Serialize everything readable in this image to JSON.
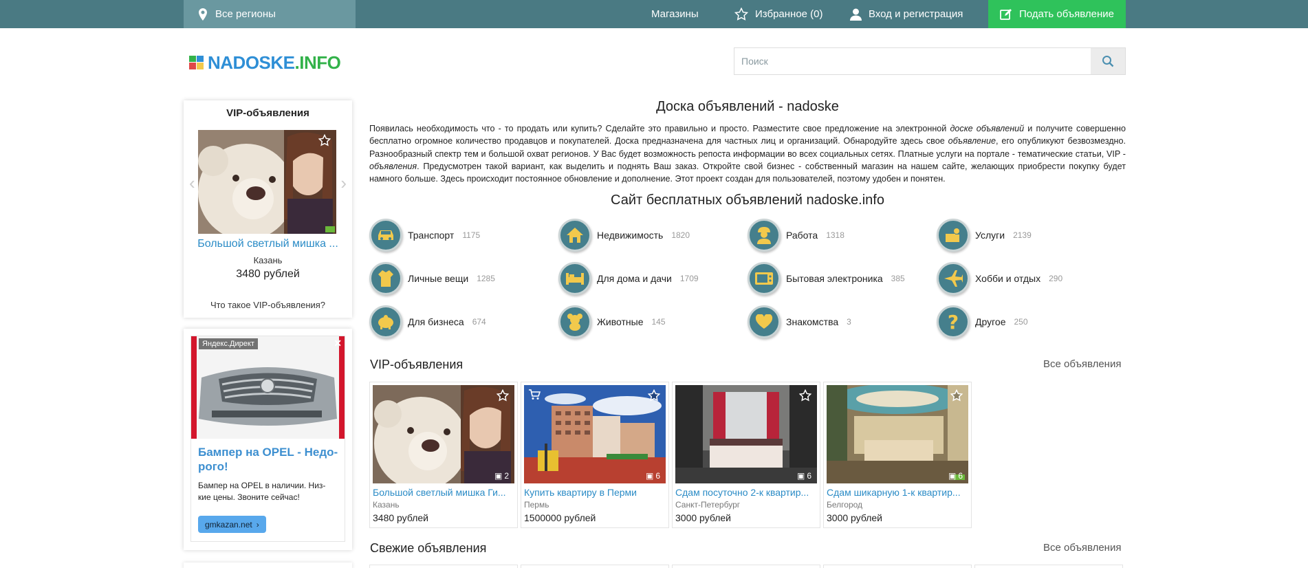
{
  "topbar": {
    "region": "Все регионы",
    "shops": "Магазины",
    "favorites": "Избранное (0)",
    "login": "Вход и регистрация",
    "post": "Подать объявление"
  },
  "header": {
    "logo_a": "NADOSKE",
    "logo_b": ".INFO",
    "search_placeholder": "Поиск"
  },
  "vip_box": {
    "title": "VIP-объявления",
    "item_title": "Большой светлый мишка ...",
    "item_city": "Казань",
    "item_price": "3480 рублей",
    "what_is": "Что такое VIP-объявления?"
  },
  "ad": {
    "label": "Яндекс.Директ",
    "title": "Бампер на OPEL - Недо-рого!",
    "text": "Бампер на OPEL в наличии. Низ-кие цены. Звоните сейчас!",
    "button": "gmkazan.net"
  },
  "main": {
    "h1": "Доска объявлений - nadoske",
    "intro_1": "Появилась необходимость что - то продать или купить? Сделайте это правильно и просто. Разместите свое предложение на электронной ",
    "intro_em1": "доске объявлений",
    "intro_2": " и получите совершенно бесплатно огромное количество продавцов и покупателей. Доска предназначена для частных лиц и организаций. Обнародуйте здесь свое ",
    "intro_em2": "объявление",
    "intro_3": ", его опубликуют безвозмездно. Разнообразный спектр тем и большой охват регионов. У Вас будет возможность репоста информации во всех социальных сетях. Платные услуги на портале - тематические статьи, VIP - ",
    "intro_em3": "объявления",
    "intro_4": ". Предусмотрен такой вариант, как выделить и поднять Ваш заказ. Откройте свой бизнес - собственный магазин на нашем сайте, желающих приобрести покупку будет намного больше. Здесь происходит постоянное обновление и дополнение. Этот проект создан для пользователей, поэтому удобен и понятен.",
    "h2": "Сайт бесплатных объявлений nadoske.info"
  },
  "categories": [
    {
      "label": "Транспорт",
      "count": "1175",
      "icon": "car-icon"
    },
    {
      "label": "Недвижимость",
      "count": "1820",
      "icon": "house-icon"
    },
    {
      "label": "Работа",
      "count": "1318",
      "icon": "worker-icon"
    },
    {
      "label": "Услуги",
      "count": "2139",
      "icon": "services-icon"
    },
    {
      "label": "Личные вещи",
      "count": "1285",
      "icon": "clothes-icon"
    },
    {
      "label": "Для дома и дачи",
      "count": "1709",
      "icon": "bed-icon"
    },
    {
      "label": "Бытовая электроника",
      "count": "385",
      "icon": "electronics-icon"
    },
    {
      "label": "Хобби и отдых",
      "count": "290",
      "icon": "plane-icon"
    },
    {
      "label": "Для бизнеса",
      "count": "674",
      "icon": "piggy-bank-icon"
    },
    {
      "label": "Животные",
      "count": "145",
      "icon": "bear-icon"
    },
    {
      "label": "Знакомства",
      "count": "3",
      "icon": "heart-icon"
    },
    {
      "label": "Другое",
      "count": "250",
      "icon": "question-icon"
    }
  ],
  "vip_section": {
    "title": "VIP-объявления",
    "all": "Все объявления",
    "cards": [
      {
        "title": "Большой светлый мишка Ги...",
        "city": "Казань",
        "price": "3480 рублей",
        "photos": "2"
      },
      {
        "title": "Купить квартиру в Перми",
        "city": "Пермь",
        "price": "1500000 рублей",
        "photos": "6"
      },
      {
        "title": "Сдам посуточно 2-к квартир...",
        "city": "Санкт-Петербург",
        "price": "3000 рублей",
        "photos": "6"
      },
      {
        "title": "Сдам шикарную 1-к квартир...",
        "city": "Белгород",
        "price": "3000 рублей",
        "photos": "6"
      }
    ]
  },
  "fresh_section": {
    "title": "Свежие объявления",
    "all": "Все объявления"
  },
  "colors": {
    "topbar": "#4a7a83",
    "region": "#6a98a0",
    "post_button": "#2fc25b",
    "link": "#2a8bc6",
    "category_icon_bg": "#457f8c",
    "category_icon_fg": "#f2c94c"
  }
}
